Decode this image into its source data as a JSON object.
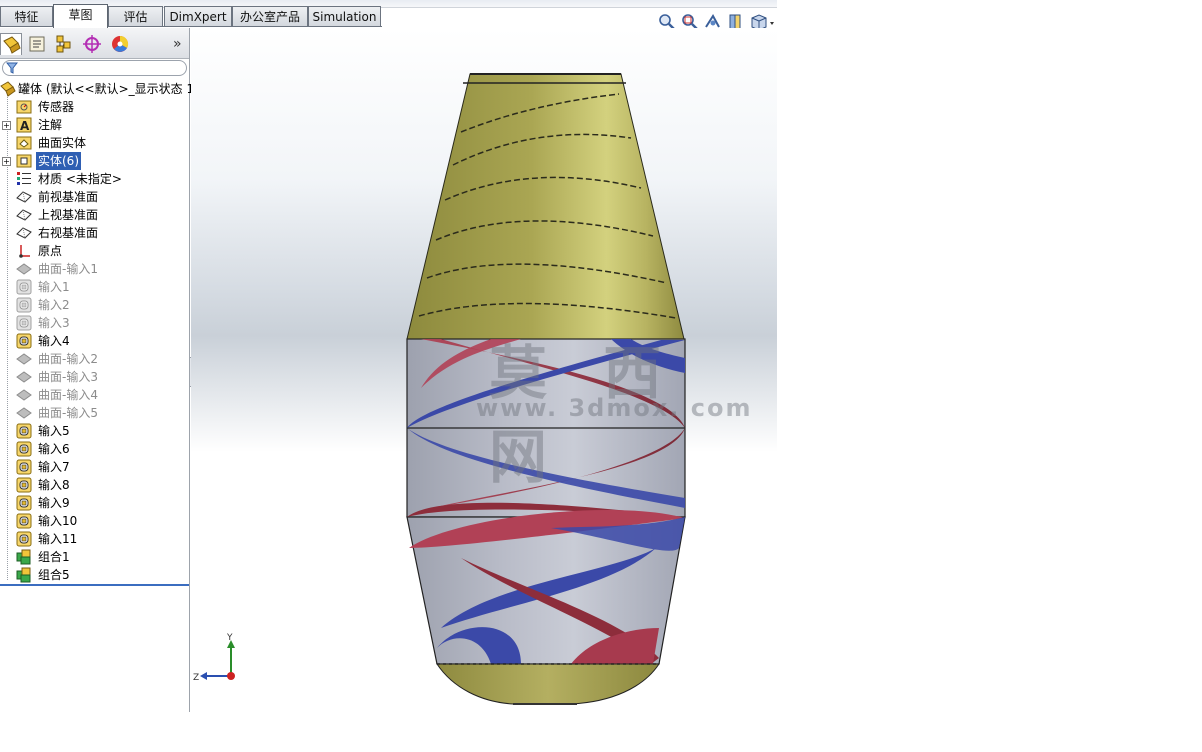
{
  "command_tabs": [
    {
      "label": "特征",
      "active": false
    },
    {
      "label": "草图",
      "active": true
    },
    {
      "label": "评估",
      "active": false
    },
    {
      "label": "DimXpert",
      "active": false
    },
    {
      "label": "办公室产品",
      "active": false
    },
    {
      "label": "Simulation",
      "active": false
    }
  ],
  "view_toolbar": [
    "zoom-to-fit-icon",
    "zoom-to-area-icon",
    "previous-view-icon",
    "section-view-icon",
    "view-orientation-icon"
  ],
  "panel_tabs": [
    "feature-manager-icon",
    "property-manager-icon",
    "configuration-manager-icon",
    "dimxpert-manager-icon",
    "display-manager-icon"
  ],
  "panel_more": "»",
  "tree": [
    {
      "label": "罐体  (默认<<默认>_显示状态 1",
      "icon": "part-icon",
      "state": "normal",
      "expand": ""
    },
    {
      "label": "传感器",
      "icon": "sensor-folder-icon",
      "state": "normal",
      "expand": ""
    },
    {
      "label": "注解",
      "icon": "annotation-icon",
      "state": "normal",
      "expand": "+"
    },
    {
      "label": "曲面实体",
      "icon": "surface-body-folder-icon",
      "state": "normal",
      "expand": ""
    },
    {
      "label": "实体(6)",
      "icon": "solid-body-folder-icon",
      "state": "selected",
      "expand": "+"
    },
    {
      "label": "材质 <未指定>",
      "icon": "material-icon",
      "state": "normal",
      "expand": ""
    },
    {
      "label": "前视基准面",
      "icon": "plane-icon",
      "state": "normal",
      "expand": ""
    },
    {
      "label": "上视基准面",
      "icon": "plane-icon",
      "state": "normal",
      "expand": ""
    },
    {
      "label": "右视基准面",
      "icon": "plane-icon",
      "state": "normal",
      "expand": ""
    },
    {
      "label": "原点",
      "icon": "origin-icon",
      "state": "normal",
      "expand": ""
    },
    {
      "label": "曲面-输入1",
      "icon": "surface-feature-icon",
      "state": "suppressed",
      "expand": ""
    },
    {
      "label": "输入1",
      "icon": "import-feature-icon",
      "state": "suppressed",
      "expand": ""
    },
    {
      "label": "输入2",
      "icon": "import-feature-icon",
      "state": "suppressed",
      "expand": ""
    },
    {
      "label": "输入3",
      "icon": "import-feature-icon",
      "state": "suppressed",
      "expand": ""
    },
    {
      "label": "输入4",
      "icon": "import-feature-icon",
      "state": "normal",
      "expand": ""
    },
    {
      "label": "曲面-输入2",
      "icon": "surface-feature-icon",
      "state": "suppressed",
      "expand": ""
    },
    {
      "label": "曲面-输入3",
      "icon": "surface-feature-icon",
      "state": "suppressed",
      "expand": ""
    },
    {
      "label": "曲面-输入4",
      "icon": "surface-feature-icon",
      "state": "suppressed",
      "expand": ""
    },
    {
      "label": "曲面-输入5",
      "icon": "surface-feature-icon",
      "state": "suppressed",
      "expand": ""
    },
    {
      "label": "输入5",
      "icon": "import-feature-icon",
      "state": "normal",
      "expand": ""
    },
    {
      "label": "输入6",
      "icon": "import-feature-icon",
      "state": "normal",
      "expand": ""
    },
    {
      "label": "输入7",
      "icon": "import-feature-icon",
      "state": "normal",
      "expand": ""
    },
    {
      "label": "输入8",
      "icon": "import-feature-icon",
      "state": "normal",
      "expand": ""
    },
    {
      "label": "输入9",
      "icon": "import-feature-icon",
      "state": "normal",
      "expand": ""
    },
    {
      "label": "输入10",
      "icon": "import-feature-icon",
      "state": "normal",
      "expand": ""
    },
    {
      "label": "输入11",
      "icon": "import-feature-icon",
      "state": "normal",
      "expand": ""
    },
    {
      "label": "组合1",
      "icon": "combine-feature-icon",
      "state": "normal",
      "expand": ""
    },
    {
      "label": "组合5",
      "icon": "combine-feature-icon",
      "state": "normal",
      "expand": ""
    }
  ],
  "watermark": {
    "title": "莫 西 网",
    "url": "www. 3dmox. com"
  },
  "triad": {
    "y": "Y",
    "z": "Z"
  },
  "colors": {
    "model_top": "#bdb95a",
    "model_bottom": "#a9a255",
    "blade_red": "#8c2c3a",
    "blade_blue": "#3c4aa6",
    "shell_grey": "#a9adbb",
    "selection": "#2f5fb3"
  }
}
